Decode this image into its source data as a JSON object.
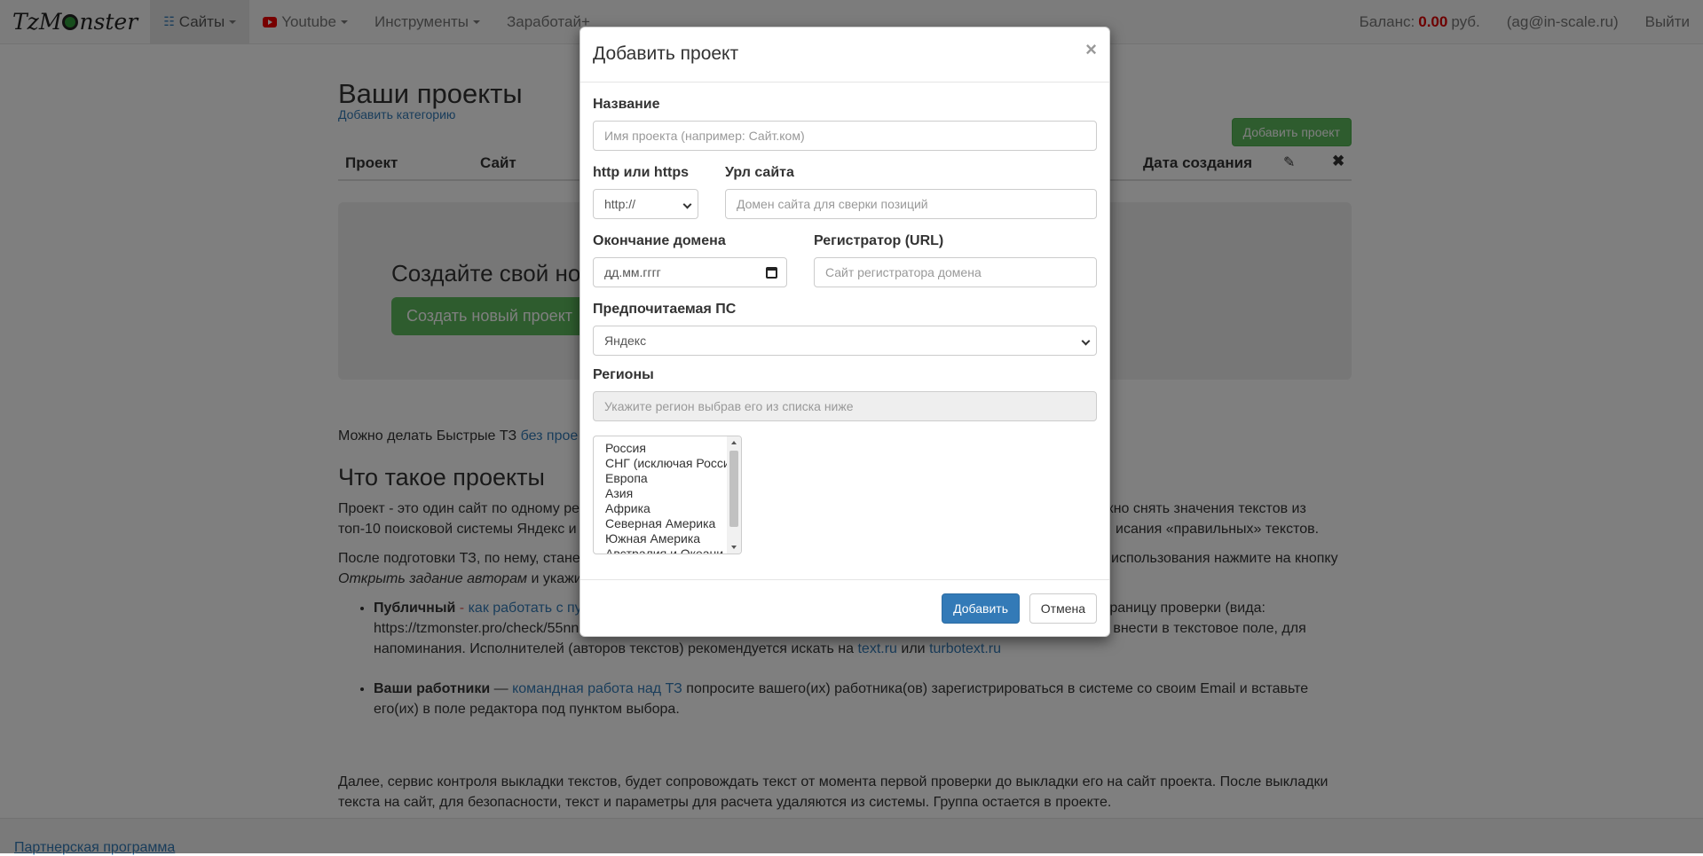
{
  "navbar": {
    "brand": "TzMonster",
    "brand_pre": "TzM",
    "brand_post": "nster",
    "sites": "Сайты",
    "youtube": "Youtube",
    "tools": "Инструменты",
    "earn": "Заработай+",
    "balance_label": "Баланс:",
    "balance_value": "0.00",
    "balance_currency": "руб.",
    "user": "(ag@in-scale.ru)",
    "logout": "Выйти"
  },
  "page": {
    "title": "Ваши проекты",
    "add_category": "Добавить категорию",
    "add_project_btn": "Добавить проект",
    "columns": {
      "project": "Проект",
      "site": "Сайт",
      "created": "Дата создания"
    },
    "empty_title": "Создайте свой но",
    "create_btn": "Создать новый проект",
    "quick_tz_text": "Можно делать Быстрые ТЗ",
    "quick_tz_link": "без прое",
    "what_title": "Что такое проекты",
    "p1_line1_a": "Проект - это один сайт по одному ре",
    "p1_line1_b": "жно снять значения текстов из",
    "p1_line2_a": "топ-10 поисковой системы Яндекс и",
    "p1_line2_b": "исания «правильных» текстов.",
    "p2_line1_a": "После подготовки ТЗ, по нему, стане",
    "p2_line1_b": "использования нажмите на кнопку",
    "p2_line2_em": "Открыть задание авторам",
    "p2_line2_rest": " и укажи",
    "li1_bold": "Публичный",
    "li1_dash": " - ",
    "li1_link": "как работать с пу",
    "li1_right": "страницу проверки (вида:",
    "li1_line2_a": "https://tzmonster.pro/check/55nn",
    "li1_line2_b": "о внести в текстовое поле, для",
    "li1_line3": "напоминания. Исполнителей (авторов текстов) рекомендуется искать на ",
    "li1_link2": "text.ru",
    "li1_or": " или ",
    "li1_link3": "turbotext.ru",
    "li2_bold": "Ваши работники",
    "li2_dash": " — ",
    "li2_link": "командная работа над ТЗ",
    "li2_text": " попросите вашего(их) работника(ов) зарегистрироваться в системе со своим Email и вставьте",
    "li2_line2": "его(их) в поле редактора под пунктом выбора.",
    "p3_line1": "Далее, сервис контроля выкладки текстов, будет сопровождать текст от момента первой проверки до выкладки его на сайт проекта. После выкладки",
    "p3_line2": "текста на сайт, для безопасности, текст и параметры для расчета удаляются из системы. Группа остается в проекте."
  },
  "footer": {
    "partner": "Партнерская программа"
  },
  "modal": {
    "title": "Добавить проект",
    "close": "×",
    "name_label": "Название",
    "name_placeholder": "Имя проекта (например: Сайт.ком)",
    "protocol_label": "http или https",
    "protocol_value": "http://",
    "url_label": "Урл сайта",
    "url_placeholder": "Домен сайта для сверки позиций",
    "domain_end_label": "Окончание домена",
    "domain_end_placeholder": "дд.мм.гггг",
    "registrar_label": "Регистратор (URL)",
    "registrar_placeholder": "Сайт регистратора домена",
    "ps_label": "Предпочитаемая ПС",
    "ps_value": "Яндекс",
    "regions_label": "Регионы",
    "regions_placeholder": "Укажите регион выбрав его из списка ниже",
    "regions_options": [
      "Россия",
      "СНГ (исключая Росси",
      "Европа",
      "Азия",
      "Африка",
      "Северная Америка",
      "Южная Америка",
      "Австралия и Океани"
    ],
    "submit": "Добавить",
    "cancel": "Отмена"
  }
}
